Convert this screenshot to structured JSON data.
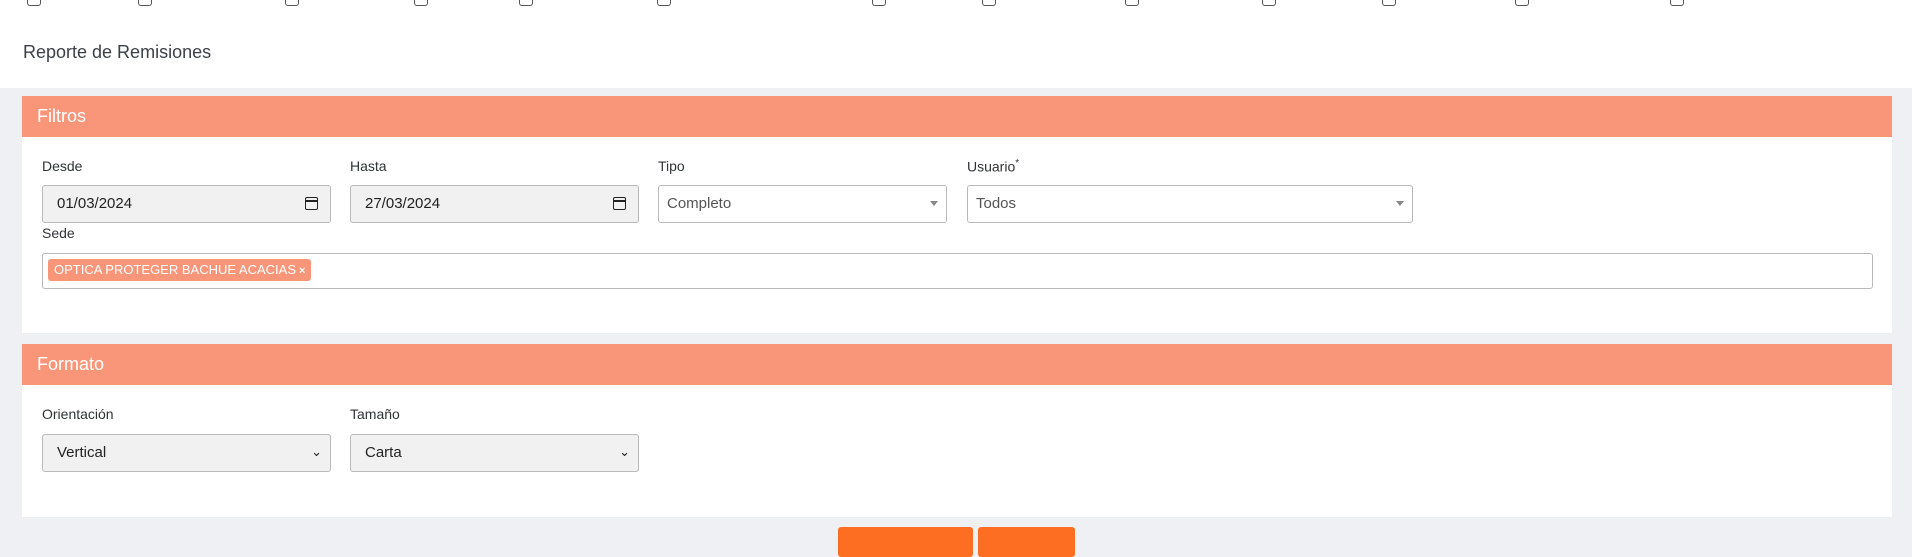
{
  "nav": {
    "icons": [
      "menu-icon-1",
      "menu-icon-2",
      "menu-icon-3",
      "menu-icon-4",
      "menu-icon-5",
      "menu-icon-6",
      "menu-icon-7",
      "menu-icon-8",
      "menu-icon-9",
      "menu-icon-10",
      "menu-icon-11",
      "menu-icon-12",
      "menu-icon-13"
    ]
  },
  "page": {
    "title": "Reporte de Remisiones"
  },
  "filtros": {
    "header": "Filtros",
    "desde": {
      "label": "Desde",
      "value": "01/03/2024"
    },
    "hasta": {
      "label": "Hasta",
      "value": "27/03/2024"
    },
    "tipo": {
      "label": "Tipo",
      "value": "Completo"
    },
    "usuario": {
      "label": "Usuario",
      "required_mark": "*",
      "value": "Todos"
    },
    "sede": {
      "label": "Sede",
      "chips": [
        {
          "label": "OPTICA PROTEGER BACHUE ACACIAS",
          "remove": "×"
        }
      ]
    }
  },
  "formato": {
    "header": "Formato",
    "orientacion": {
      "label": "Orientación",
      "value": "Vertical"
    },
    "tamano": {
      "label": "Tamaño",
      "value": "Carta"
    }
  },
  "colors": {
    "accent": "#f9967a",
    "button": "#fd6d22",
    "background": "#eef0f3"
  }
}
